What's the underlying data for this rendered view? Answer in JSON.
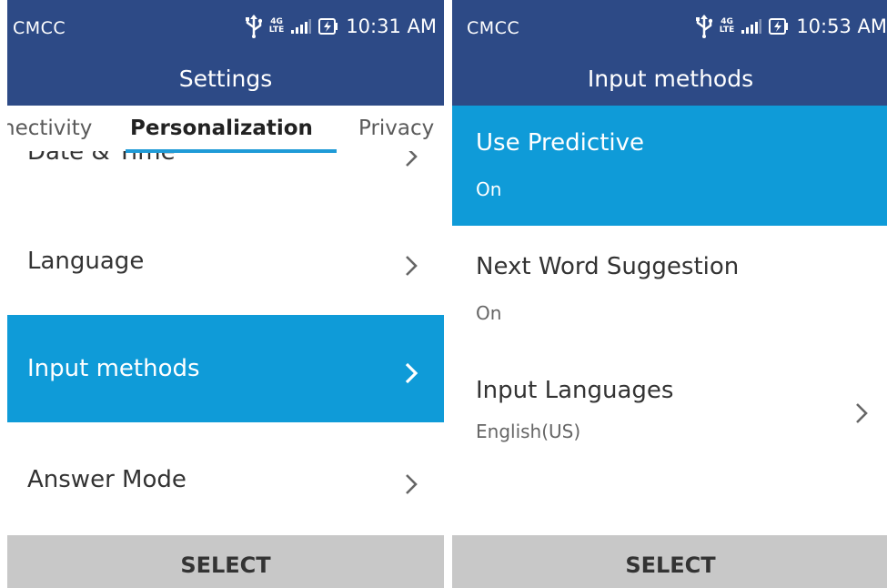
{
  "left": {
    "status": {
      "carrier": "CMCC",
      "network": "4G",
      "network_sub": "LTE",
      "time": "10:31 AM"
    },
    "title": "Settings",
    "tabs": {
      "left": "nectivity",
      "active": "Personalization",
      "right": "Privacy"
    },
    "items": [
      {
        "label": "Date & Time"
      },
      {
        "label": "Language"
      },
      {
        "label": "Input methods",
        "selected": true
      },
      {
        "label": "Answer Mode"
      }
    ],
    "softkey": "SELECT"
  },
  "right": {
    "status": {
      "carrier": "CMCC",
      "network": "4G",
      "network_sub": "LTE",
      "time": "10:53 AM"
    },
    "title": "Input methods",
    "items": [
      {
        "label": "Use Predictive",
        "value": "On",
        "selected": true
      },
      {
        "label": "Next Word Suggestion",
        "value": "On"
      },
      {
        "label": "Input Languages",
        "value": "English(US)"
      }
    ],
    "softkey": "SELECT"
  },
  "colors": {
    "header": "#2d4a86",
    "highlight": "#0f9bd8",
    "tab_underline": "#1f9bd7",
    "softkey_bar": "#c8c8c8"
  },
  "icons": [
    "usb-icon",
    "signal-icon",
    "battery-charging-icon",
    "chevron-right-icon"
  ]
}
